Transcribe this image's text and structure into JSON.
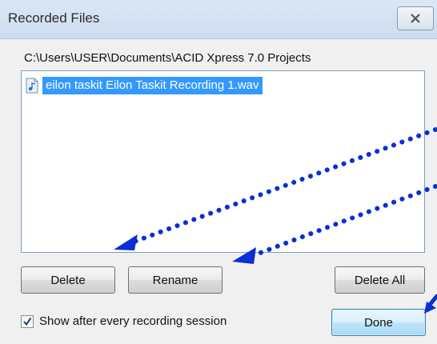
{
  "window": {
    "title": "Recorded Files"
  },
  "folder_path": "C:\\Users\\USER\\Documents\\ACID Xpress 7.0 Projects",
  "files": [
    {
      "name": "eilon taskit Eilon Taskit Recording 1.wav",
      "icon": "wav-audio-file-icon",
      "selected": true
    }
  ],
  "buttons": {
    "delete": "Delete",
    "rename": "Rename",
    "delete_all": "Delete All",
    "done": "Done"
  },
  "options": {
    "show_after_session_label": "Show after every recording session",
    "show_after_session_checked": true
  },
  "annotation_color": "#0a2fd6",
  "colors": {
    "selection": "#3399ff",
    "titlebar": "#d4e2f3"
  }
}
